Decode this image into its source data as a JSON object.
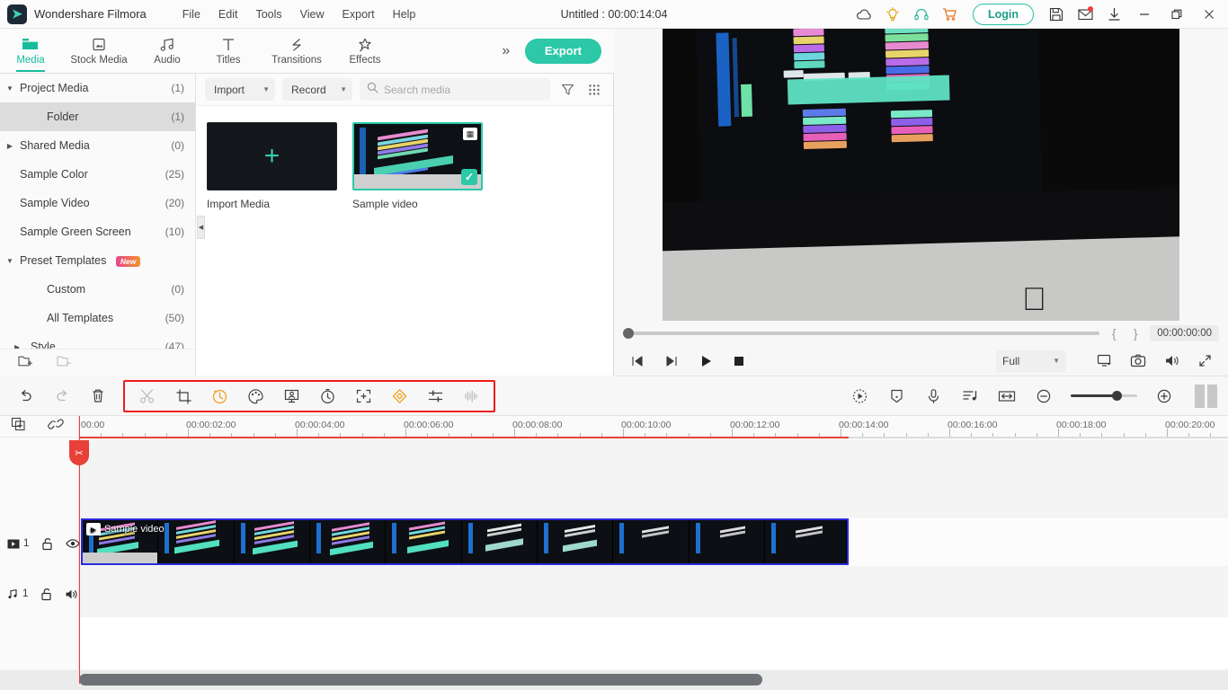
{
  "titlebar": {
    "app_name": "Wondershare Filmora",
    "menus": [
      "File",
      "Edit",
      "Tools",
      "View",
      "Export",
      "Help"
    ],
    "project_title": "Untitled : 00:00:14:04",
    "login_label": "Login",
    "icons": [
      "cloud-icon",
      "lightbulb-icon",
      "headset-icon",
      "cart-icon",
      "save-icon",
      "mail-icon",
      "download-icon"
    ],
    "window_controls": [
      "minimize",
      "maximize",
      "close"
    ]
  },
  "main_toolbar": {
    "tabs": [
      {
        "label": "Media",
        "icon": "folder-icon",
        "active": true
      },
      {
        "label": "Stock Media",
        "icon": "stock-media-icon",
        "active": false
      },
      {
        "label": "Audio",
        "icon": "music-note-icon",
        "active": false
      },
      {
        "label": "Titles",
        "icon": "text-t-icon",
        "active": false
      },
      {
        "label": "Transitions",
        "icon": "transition-icon",
        "active": false
      },
      {
        "label": "Effects",
        "icon": "effects-star-icon",
        "active": false
      }
    ],
    "expand_label": "»",
    "export_label": "Export"
  },
  "sidebar": {
    "items": [
      {
        "label": "Project Media",
        "count": "(1)",
        "arrow": "down",
        "indent": 0,
        "selected": false
      },
      {
        "label": "Folder",
        "count": "(1)",
        "arrow": "",
        "indent": 1,
        "selected": true
      },
      {
        "label": "Shared Media",
        "count": "(0)",
        "arrow": "right",
        "indent": 0,
        "selected": false
      },
      {
        "label": "Sample Color",
        "count": "(25)",
        "arrow": "",
        "indent": 0,
        "selected": false
      },
      {
        "label": "Sample Video",
        "count": "(20)",
        "arrow": "",
        "indent": 0,
        "selected": false
      },
      {
        "label": "Sample Green Screen",
        "count": "(10)",
        "arrow": "",
        "indent": 0,
        "selected": false
      },
      {
        "label": "Preset Templates",
        "count": "",
        "arrow": "down",
        "indent": 0,
        "selected": false,
        "badge": "New"
      },
      {
        "label": "Custom",
        "count": "(0)",
        "arrow": "",
        "indent": 1,
        "selected": false
      },
      {
        "label": "All Templates",
        "count": "(50)",
        "arrow": "",
        "indent": 1,
        "selected": false
      },
      {
        "label": "Style",
        "count": "(47)",
        "arrow": "right",
        "indent": 1,
        "selected": false
      }
    ],
    "footer": [
      "new-folder-icon",
      "delete-folder-icon"
    ]
  },
  "media_panel": {
    "import_label": "Import",
    "record_label": "Record",
    "search_placeholder": "Search media",
    "search_value": "",
    "filter_icon": "filter-icon",
    "view_icon": "grid-view-icon",
    "items": [
      {
        "label": "Import Media",
        "type": "import"
      },
      {
        "label": "Sample video",
        "type": "video",
        "selected": true
      }
    ]
  },
  "preview": {
    "timecode": "00:00:00:00",
    "mark_in": "{",
    "mark_out": "}",
    "quality": "Full",
    "controls": [
      "prev-frame",
      "next-frame",
      "play",
      "stop"
    ],
    "right_icons": [
      "screen-icon",
      "snapshot-camera-icon",
      "volume-icon",
      "fullscreen-icon"
    ]
  },
  "edit_toolbar": {
    "left_icons": [
      "undo-icon",
      "redo-icon",
      "delete-icon"
    ],
    "highlighted_icons": [
      "split-scissors-icon",
      "crop-icon",
      "speed-icon",
      "color-palette-icon",
      "green-screen-icon",
      "stabilization-icon",
      "auto-reframe-icon",
      "keyframe-diamond-icon",
      "audio-mixer-icon",
      "audio-waveform-icon"
    ],
    "right_icons": [
      "motion-tracking-icon",
      "marker-icon",
      "voiceover-mic-icon",
      "audio-beat-icon",
      "fit-timeline-icon"
    ],
    "zoom_out": "−",
    "zoom_in": "+",
    "highlight_color": "#ee1c1c"
  },
  "timeline": {
    "head_tools": [
      "add-track-icon",
      "link-icon"
    ],
    "ruler_labels": [
      "00:00",
      "00:00:02:00",
      "00:00:04:00",
      "00:00:06:00",
      "00:00:08:00",
      "00:00:10:00",
      "00:00:12:00",
      "00:00:14:00",
      "00:00:16:00",
      "00:00:18:00",
      "00:00:20:00"
    ],
    "tracks": [
      {
        "type": "video",
        "number": "1",
        "lock": "unlocked",
        "toggle": "eye-icon"
      },
      {
        "type": "audio",
        "number": "1",
        "lock": "unlocked",
        "toggle": "speaker-icon"
      }
    ],
    "clips": [
      {
        "label": "Sample video",
        "track": "video",
        "selected": true
      }
    ],
    "playhead_position": "00:00:00:00"
  }
}
